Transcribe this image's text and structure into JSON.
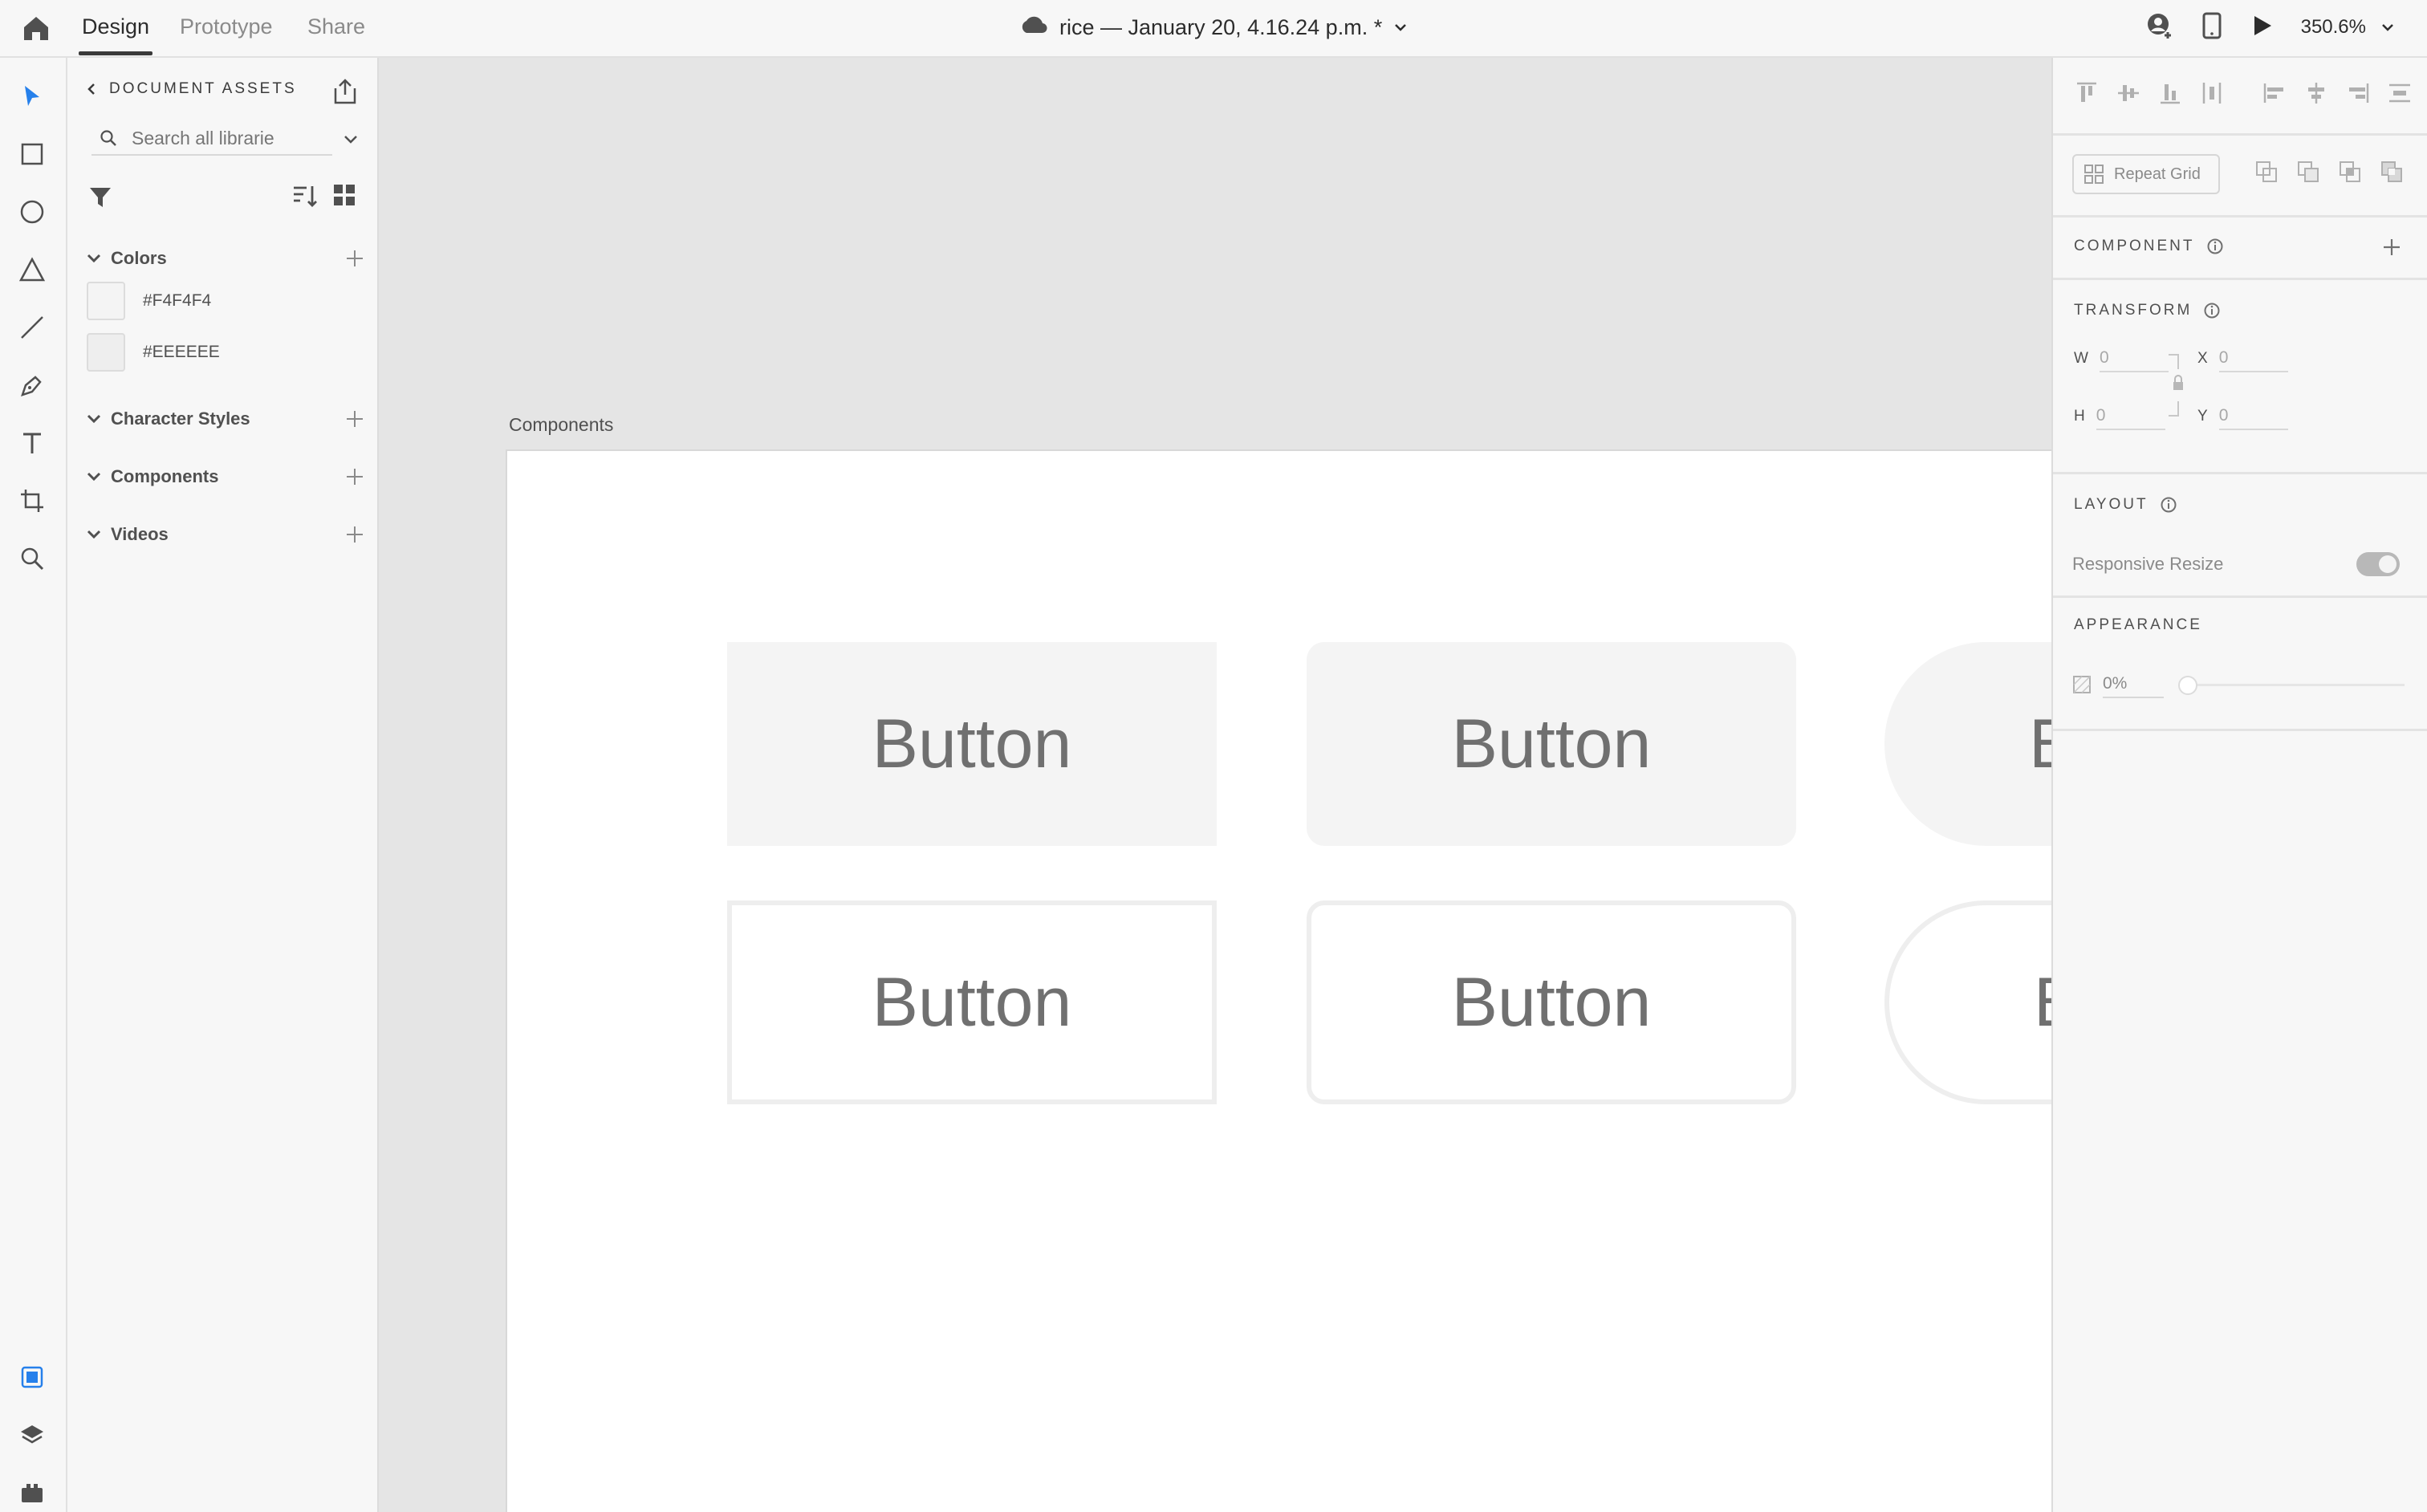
{
  "topbar": {
    "tabs": [
      {
        "label": "Design",
        "active": true
      },
      {
        "label": "Prototype",
        "active": false
      },
      {
        "label": "Share",
        "active": false
      }
    ],
    "doc_title": "rice — January 20, 4.16.24 p.m. *",
    "zoom": "350.6%"
  },
  "tools": [
    "select-icon",
    "rectangle-icon",
    "ellipse-icon",
    "polygon-icon",
    "line-icon",
    "pen-icon",
    "text-icon",
    "artboard-icon",
    "zoom-icon",
    "assets-icon",
    "layers-icon",
    "plugins-icon"
  ],
  "assets": {
    "title": "DOCUMENT ASSETS",
    "search_placeholder": "Search all librarie",
    "sections": {
      "colors": "Colors",
      "character_styles": "Character Styles",
      "components": "Components",
      "videos": "Videos"
    },
    "colors": [
      {
        "hex": "#F4F4F4",
        "label": "#F4F4F4"
      },
      {
        "hex": "#EEEEEE",
        "label": "#EEEEEE"
      }
    ]
  },
  "canvas": {
    "artboard_label": "Components",
    "buttons": [
      {
        "label": "Button",
        "style": "filled-square"
      },
      {
        "label": "Button",
        "style": "filled-rounded"
      },
      {
        "label": "B",
        "style": "filled-pill"
      },
      {
        "label": "Button",
        "style": "outlined-square"
      },
      {
        "label": "Button",
        "style": "outlined-rounded"
      },
      {
        "label": "B",
        "style": "outlined-pill"
      }
    ]
  },
  "properties": {
    "repeat_grid": "Repeat Grid",
    "component_heading": "COMPONENT",
    "transform_heading": "TRANSFORM",
    "w_label": "W",
    "w_value": "0",
    "h_label": "H",
    "h_value": "0",
    "x_label": "X",
    "x_value": "0",
    "y_label": "Y",
    "y_value": "0",
    "layout_heading": "LAYOUT",
    "responsive_resize": "Responsive Resize",
    "responsive_on": true,
    "appearance_heading": "APPEARANCE",
    "opacity": "0%"
  },
  "colors": {
    "accent": "#2680eb",
    "panel": "#f7f7f7",
    "canvas": "#e5e5e5"
  }
}
